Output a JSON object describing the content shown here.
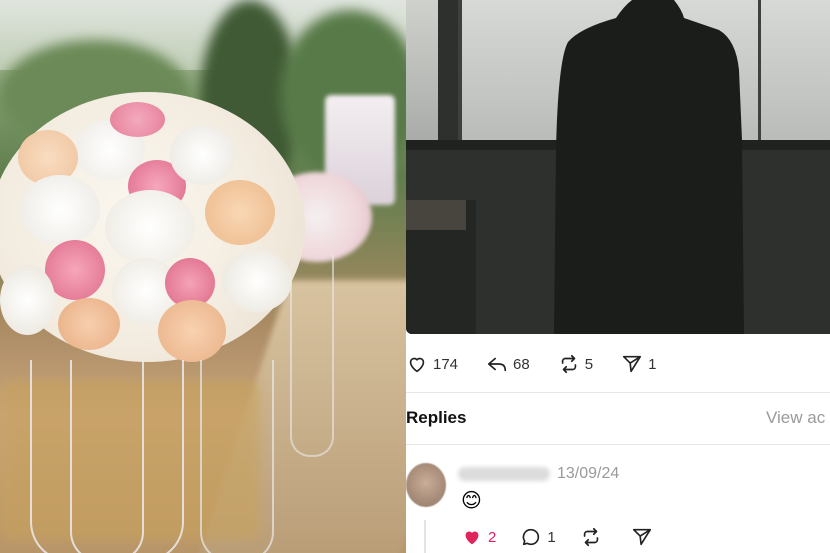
{
  "left_image": {
    "description_icon": "wedding-flowers-photo"
  },
  "post": {
    "image_icon": "man-by-window-photo",
    "actions": {
      "likes": "174",
      "replies": "68",
      "reposts": "5",
      "shares": "1"
    }
  },
  "replies_section": {
    "title": "Replies",
    "view_activity": "View ac"
  },
  "reply": {
    "date": "13/09/24",
    "text": "😊",
    "likes": "2",
    "comments": "1"
  },
  "colors": {
    "like_red": "#e0245e",
    "muted_text": "#9a9a9a"
  }
}
